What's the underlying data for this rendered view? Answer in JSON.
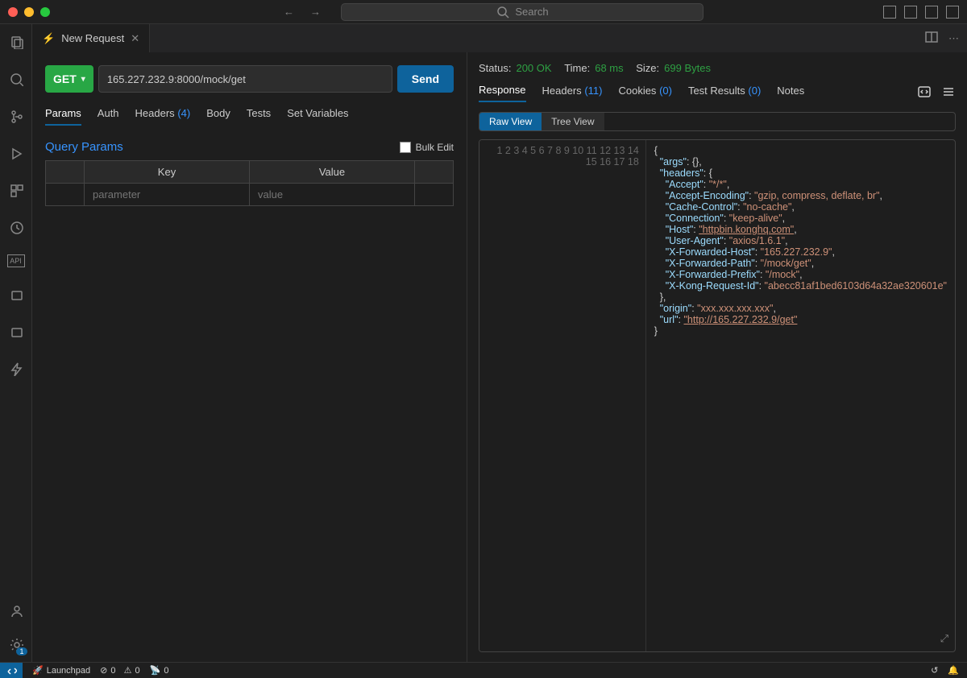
{
  "titlebar": {
    "search_placeholder": "Search"
  },
  "tab": {
    "title": "New Request"
  },
  "request": {
    "method": "GET",
    "url": "165.227.232.9:8000/mock/get",
    "send": "Send"
  },
  "reqtabs": {
    "params": "Params",
    "auth": "Auth",
    "headers": "Headers",
    "headers_count": "(4)",
    "body": "Body",
    "tests": "Tests",
    "vars": "Set Variables"
  },
  "query": {
    "title": "Query Params",
    "bulk": "Bulk Edit",
    "col_key": "Key",
    "col_value": "Value",
    "ph_key": "parameter",
    "ph_value": "value"
  },
  "status": {
    "status_lbl": "Status:",
    "status_val": "200 OK",
    "time_lbl": "Time:",
    "time_val": "68 ms",
    "size_lbl": "Size:",
    "size_val": "699 Bytes"
  },
  "resptabs": {
    "response": "Response",
    "headers": "Headers",
    "headers_count": "(11)",
    "cookies": "Cookies",
    "cookies_count": "(0)",
    "tests": "Test Results",
    "tests_count": "(0)",
    "notes": "Notes"
  },
  "view": {
    "raw": "Raw View",
    "tree": "Tree View"
  },
  "json_lines": [
    "{",
    "  \"args\": {},",
    "  \"headers\": {",
    "    \"Accept\": \"*/*\",",
    "    \"Accept-Encoding\": \"gzip, compress, deflate, br\",",
    "    \"Cache-Control\": \"no-cache\",",
    "    \"Connection\": \"keep-alive\",",
    "    \"Host\": \"httpbin.konghq.com\",",
    "    \"User-Agent\": \"axios/1.6.1\",",
    "    \"X-Forwarded-Host\": \"165.227.232.9\",",
    "    \"X-Forwarded-Path\": \"/mock/get\",",
    "    \"X-Forwarded-Prefix\": \"/mock\",",
    "    \"X-Kong-Request-Id\": \"abecc81af1bed6103d64a32ae320601e\"",
    "  },",
    "  \"origin\": \"xxx.xxx.xxx.xxx\",",
    "  \"url\": \"http://165.227.232.9/get\"",
    "}",
    ""
  ],
  "statusbar": {
    "launchpad": "Launchpad",
    "errors": "0",
    "warnings": "0",
    "ports": "0"
  }
}
